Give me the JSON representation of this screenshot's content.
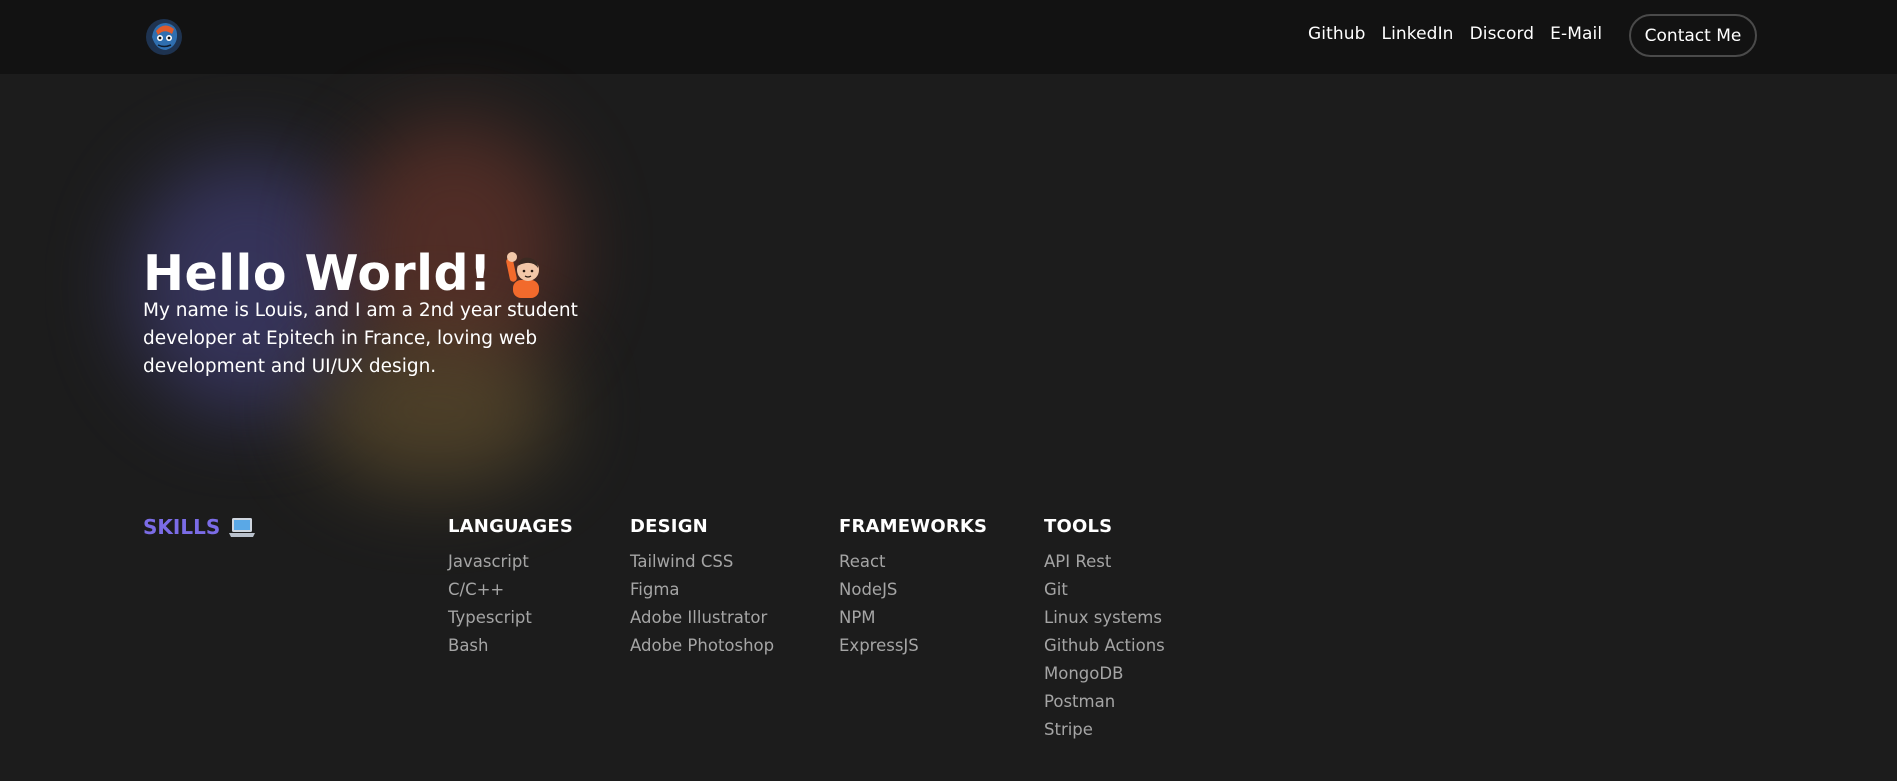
{
  "header": {
    "nav": [
      {
        "label": "Github",
        "name": "nav-github"
      },
      {
        "label": "LinkedIn",
        "name": "nav-linkedin"
      },
      {
        "label": "Discord",
        "name": "nav-discord"
      },
      {
        "label": "E-Mail",
        "name": "nav-email"
      }
    ],
    "contact_label": "Contact Me"
  },
  "hero": {
    "title": "Hello World!",
    "description": "My name is Louis, and I am a 2nd year student developer at Epitech in France, loving web development and UI/UX design."
  },
  "skills": {
    "title": "SKILLS",
    "accent_color": "#7b6ce6",
    "columns": [
      {
        "heading": "LANGUAGES",
        "items": [
          "Javascript",
          "C/C++",
          "Typescript",
          "Bash"
        ]
      },
      {
        "heading": "DESIGN",
        "items": [
          "Tailwind CSS",
          "Figma",
          "Adobe Illustrator",
          "Adobe Photoshop"
        ]
      },
      {
        "heading": "FRAMEWORKS",
        "items": [
          "React",
          "NodeJS",
          "NPM",
          "ExpressJS"
        ]
      },
      {
        "heading": "TOOLS",
        "items": [
          "API Rest",
          "Git",
          "Linux systems",
          "Github Actions",
          "MongoDB",
          "Postman",
          "Stripe"
        ]
      }
    ]
  },
  "icons": {
    "logo": "avatar-logo-icon",
    "wave": "waving-hand-icon",
    "laptop": "laptop-icon"
  }
}
